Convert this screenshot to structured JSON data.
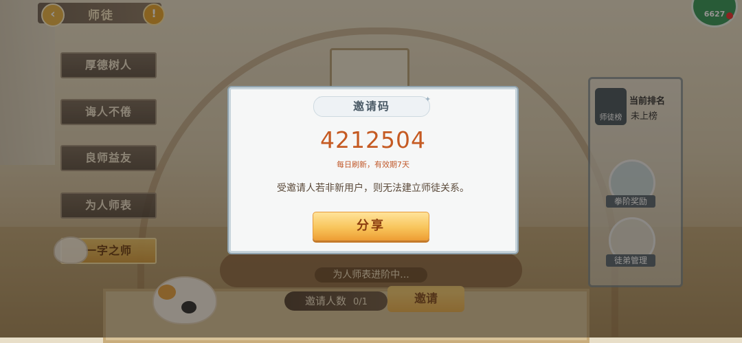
{
  "header": {
    "title": "师徒",
    "back_icon": "chevron-left-icon",
    "info_icon": "exclamation-icon"
  },
  "corner_badge": "6627",
  "side_menu": [
    {
      "label": "厚德树人",
      "active": false
    },
    {
      "label": "诲人不倦",
      "active": false
    },
    {
      "label": "良师益友",
      "active": false
    },
    {
      "label": "为人师表",
      "active": false
    },
    {
      "label": "一字之师",
      "active": true
    }
  ],
  "right_panel": {
    "rank_icon_label": "师徒榜",
    "rank_title": "当前排名",
    "rank_value": "未上榜",
    "reward_label": "拳阶奖励",
    "manage_label": "徒弟管理"
  },
  "bottom": {
    "progress_text": "为人师表进阶中...",
    "invite_count_label": "邀请人数",
    "invite_count_value": "0/1",
    "invite_button": "邀请"
  },
  "dialog": {
    "title": "邀请码",
    "code": "4212504",
    "refresh_note": "每日刷新，有效期7天",
    "description": "受邀请人若非新用户，则无法建立师徒关系。",
    "share_button": "分享"
  },
  "colors": {
    "accent_orange": "#c55a22",
    "button_gold": "#f8c55c",
    "dialog_bg": "#f6f7f7"
  }
}
